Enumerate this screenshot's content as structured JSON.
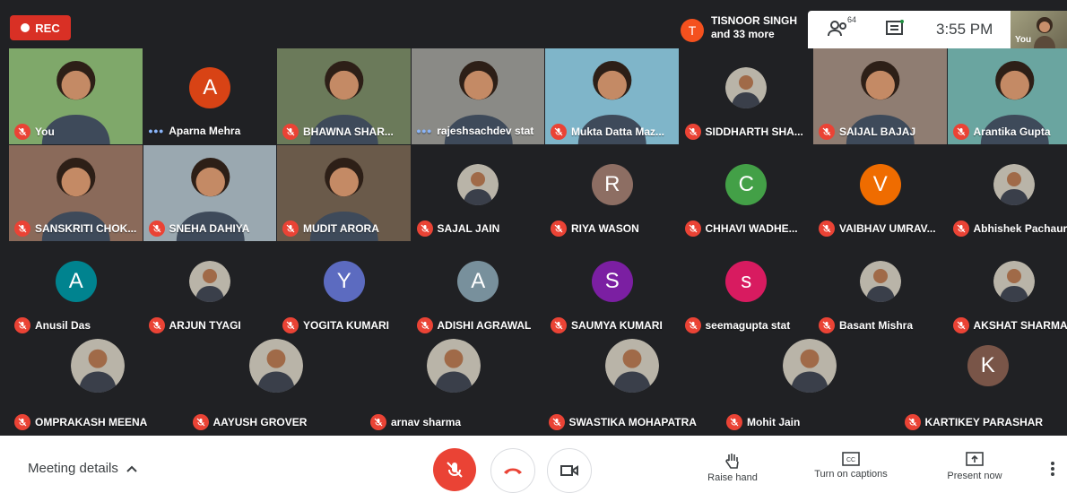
{
  "recording": {
    "label": "REC"
  },
  "active_speaker": {
    "initial": "T",
    "line1": "TISNOOR SINGH",
    "line2": "and 33 more"
  },
  "header": {
    "participant_count": "64",
    "time": "3:55 PM",
    "self_label": "You"
  },
  "tiles": [
    {
      "name": "You",
      "kind": "video",
      "muted": true
    },
    {
      "name": "Aparna Mehra",
      "kind": "letter",
      "letter": "A",
      "color": "#d84315",
      "dots": true
    },
    {
      "name": "BHAWNA SHAR...",
      "kind": "video",
      "muted": true
    },
    {
      "name": "rajeshsachdev stat",
      "kind": "video",
      "dots": true
    },
    {
      "name": "Mukta Datta Maz...",
      "kind": "video",
      "muted": true
    },
    {
      "name": "SIDDHARTH SHA...",
      "kind": "photo",
      "muted": true
    },
    {
      "name": "SAIJAL BAJAJ",
      "kind": "video",
      "muted": true
    },
    {
      "name": "Arantika Gupta",
      "kind": "video",
      "muted": true
    },
    {
      "name": "SANSKRITI CHOK...",
      "kind": "video",
      "muted": true
    },
    {
      "name": "SNEHA DAHIYA",
      "kind": "video",
      "muted": true
    },
    {
      "name": "MUDIT ARORA",
      "kind": "video",
      "muted": true
    },
    {
      "name": "SAJAL JAIN",
      "kind": "photo",
      "muted": true
    },
    {
      "name": "RIYA WASON",
      "kind": "letter",
      "letter": "R",
      "color": "#8d6e63",
      "muted": true
    },
    {
      "name": "CHHAVI WADHE...",
      "kind": "letter",
      "letter": "C",
      "color": "#43a047",
      "muted": true
    },
    {
      "name": "VAIBHAV UMRAV...",
      "kind": "letter",
      "letter": "V",
      "color": "#ef6c00",
      "muted": true
    },
    {
      "name": "Abhishek Pachauri",
      "kind": "photo",
      "muted": true
    },
    {
      "name": "Anusil Das",
      "kind": "letter",
      "letter": "A",
      "color": "#00838f",
      "muted": true
    },
    {
      "name": "ARJUN TYAGI",
      "kind": "photo",
      "muted": true
    },
    {
      "name": "YOGITA KUMARI",
      "kind": "letter",
      "letter": "Y",
      "color": "#5c6bc0",
      "muted": true
    },
    {
      "name": "ADISHI AGRAWAL",
      "kind": "letter",
      "letter": "A",
      "color": "#78909c",
      "muted": true
    },
    {
      "name": "SAUMYA KUMARI",
      "kind": "letter",
      "letter": "S",
      "color": "#7b1fa2",
      "muted": true
    },
    {
      "name": "seemagupta stat",
      "kind": "letter",
      "letter": "s",
      "color": "#d81b60",
      "muted": true
    },
    {
      "name": "Basant Mishra",
      "kind": "photo",
      "muted": true
    },
    {
      "name": "AKSHAT SHARMA",
      "kind": "photo",
      "muted": true
    },
    {
      "name": "OMPRAKASH MEENA",
      "kind": "photo",
      "muted": true
    },
    {
      "name": "AAYUSH GROVER",
      "kind": "photo",
      "muted": true
    },
    {
      "name": "arnav sharma",
      "kind": "photo",
      "muted": true
    },
    {
      "name": "SWASTIKA MOHAPATRA",
      "kind": "photo",
      "muted": true
    },
    {
      "name": "Mohit Jain",
      "kind": "photo",
      "muted": true
    },
    {
      "name": "KARTIKEY PARASHAR",
      "kind": "letter",
      "letter": "K",
      "color": "#795548",
      "muted": true
    }
  ],
  "bottom": {
    "meeting_details": "Meeting details",
    "raise_hand": "Raise hand",
    "captions": "Turn on captions",
    "present": "Present now"
  }
}
